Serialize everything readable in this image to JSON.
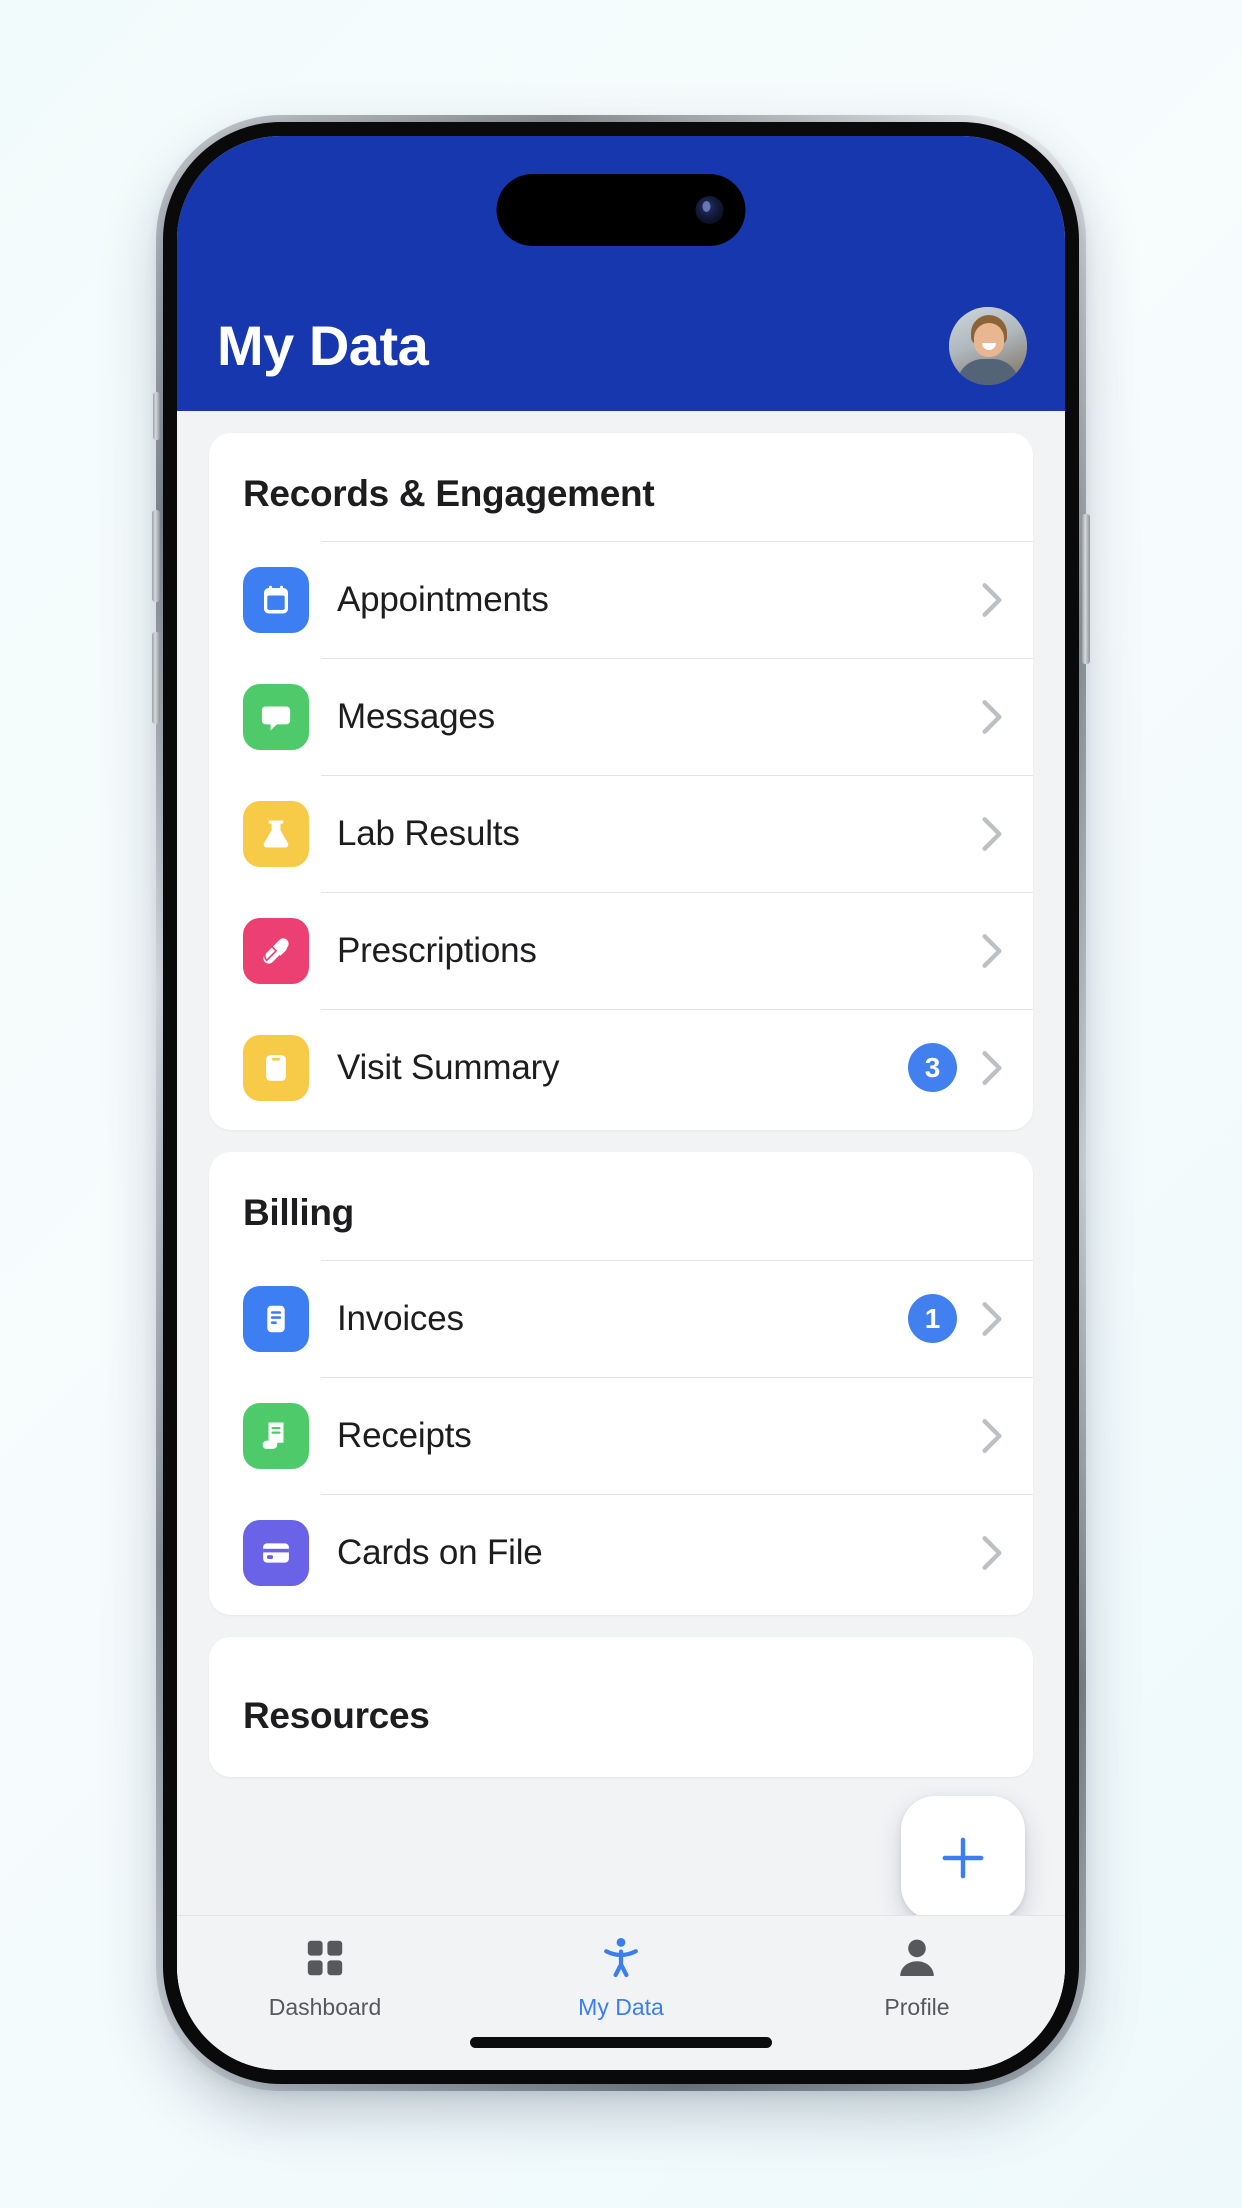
{
  "header": {
    "title": "My Data",
    "background_color": "#1637ae",
    "avatar_name": "user-avatar"
  },
  "colors": {
    "accent_blue": "#4280f0",
    "header_blue": "#1637ae",
    "icon_blue": "#3d7ff2",
    "icon_green": "#4fca6a",
    "icon_yellow": "#f7cb47",
    "icon_pink": "#ec3f72",
    "icon_purple": "#6a63e8",
    "tab_active": "#3c7ef0",
    "tab_inactive": "#56585c"
  },
  "sections": [
    {
      "title": "Records & Engagement",
      "items": [
        {
          "label": "Appointments",
          "icon": "calendar-icon",
          "icon_color": "#3d7ff2",
          "badge": ""
        },
        {
          "label": "Messages",
          "icon": "chat-icon",
          "icon_color": "#4fca6a",
          "badge": ""
        },
        {
          "label": "Lab Results",
          "icon": "flask-icon",
          "icon_color": "#f7cb47",
          "badge": ""
        },
        {
          "label": "Prescriptions",
          "icon": "pill-icon",
          "icon_color": "#ec3f72",
          "badge": ""
        },
        {
          "label": "Visit Summary",
          "icon": "clipboard-icon",
          "icon_color": "#f7cb47",
          "badge": "3"
        }
      ]
    },
    {
      "title": "Billing",
      "items": [
        {
          "label": "Invoices",
          "icon": "document-icon",
          "icon_color": "#3d7ff2",
          "badge": "1"
        },
        {
          "label": "Receipts",
          "icon": "receipt-icon",
          "icon_color": "#4fca6a",
          "badge": ""
        },
        {
          "label": "Cards on File",
          "icon": "creditcard-icon",
          "icon_color": "#6a63e8",
          "badge": ""
        }
      ]
    },
    {
      "title": "Resources",
      "items": []
    }
  ],
  "fab": {
    "icon": "plus-icon",
    "label": "+"
  },
  "tab_bar": {
    "items": [
      {
        "label": "Dashboard",
        "icon": "grid-icon",
        "active": false
      },
      {
        "label": "My Data",
        "icon": "person-accessibility-icon",
        "active": true
      },
      {
        "label": "Profile",
        "icon": "person-icon",
        "active": false
      }
    ]
  }
}
